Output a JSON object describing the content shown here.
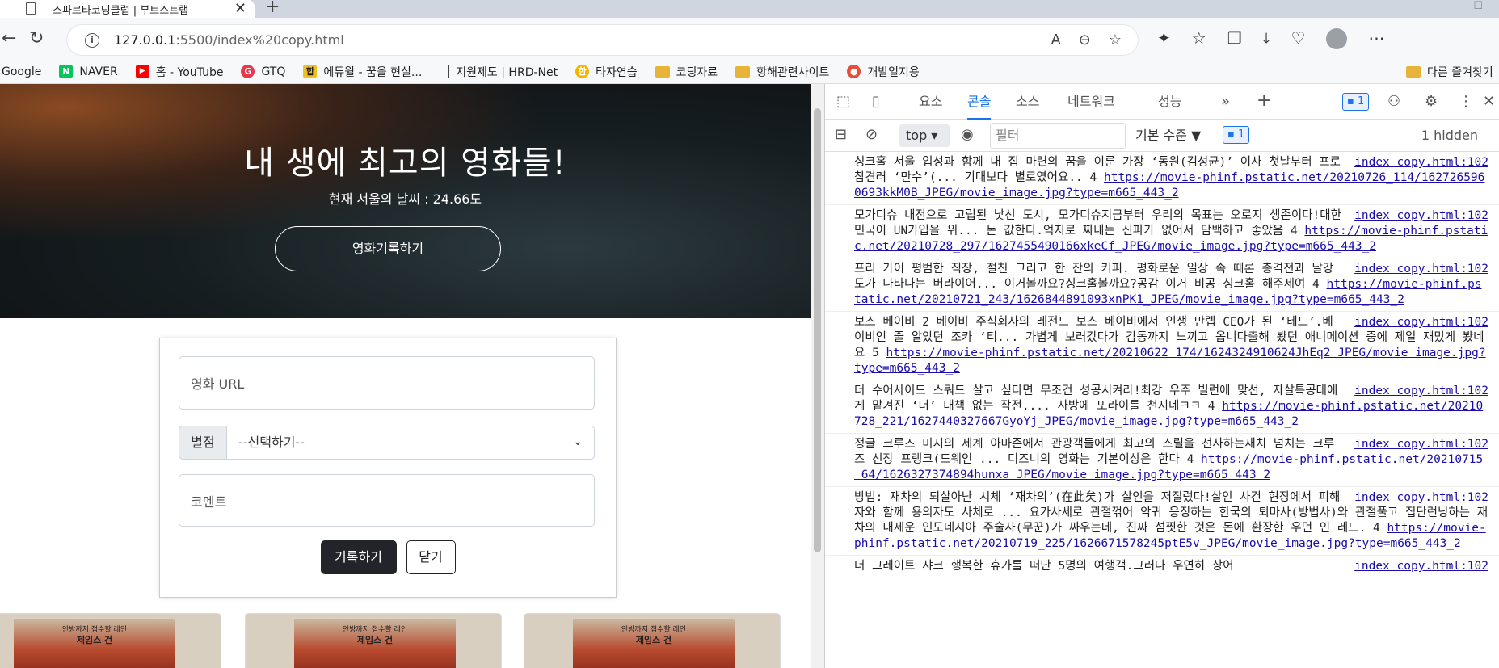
{
  "browser": {
    "tab_title": "스파르타코딩클럽 | 부트스트랩 ",
    "url_host": "127.0.0.1",
    "url_rest": ":5500/index%20copy.html",
    "bookmarks": [
      {
        "label": "Google",
        "color": "#ffffff",
        "type": "text"
      },
      {
        "label": "NAVER",
        "color": "#03c75a",
        "type": "icon",
        "glyph": "N"
      },
      {
        "label": "홈 - YouTube",
        "color": "#ff0000",
        "type": "icon",
        "glyph": "▶"
      },
      {
        "label": "GTQ",
        "color": "#e8384f",
        "type": "icon",
        "glyph": "G"
      },
      {
        "label": "에듀윌 - 꿈을 현실...",
        "color": "#f0c020",
        "type": "icon",
        "glyph": "합"
      },
      {
        "label": "지원제도 | HRD-Net",
        "color": "#ffffff",
        "type": "doc"
      },
      {
        "label": "타자연습",
        "color": "#f5b400",
        "type": "icon",
        "glyph": "한"
      },
      {
        "label": "코딩자료",
        "color": "#e8b33b",
        "type": "folder"
      },
      {
        "label": "항해관련사이트",
        "color": "#e8b33b",
        "type": "folder"
      },
      {
        "label": "개발일지용",
        "color": "#e84c3d",
        "type": "icon",
        "glyph": "●"
      }
    ],
    "other_bookmarks": "다른 즐겨찾기"
  },
  "hero": {
    "title": "내 생에 최고의 영화들!",
    "weather": "현재 서울의 날씨 : 24.66도",
    "record_button": "영화기록하기"
  },
  "form": {
    "url_placeholder": "영화 URL",
    "star_label": "별점",
    "star_select": "--선택하기--",
    "comment_placeholder": "코멘트",
    "save_button": "기록하기",
    "close_button": "닫기"
  },
  "cards": [
    {
      "line1": "안방까지 접수할 레인",
      "line2": "제임스 건"
    },
    {
      "line1": "안방까지 접수할 레인",
      "line2": "제임스 건"
    },
    {
      "line1": "안방까지 접수할 레인",
      "line2": "제임스 건"
    }
  ],
  "devtools": {
    "tabs": [
      "요소",
      "콘솔",
      "소스",
      "네트워크",
      "성능"
    ],
    "active_tab": "콘솔",
    "issue_count": "1",
    "context": "top",
    "filter_placeholder": "필터",
    "levels": "기본 수준",
    "levels_badge": "1",
    "hidden": "1 hidden",
    "messages": [
      {
        "text": "싱크홀 서울 입성과 함께 내 집 마련의 꿈을 이룬 가장 ‘동원(김성균)’ 이사 첫날부터 프로 참견러 ‘만수’(... 기대보다 별로였어요.. 4 ",
        "link": "https://movie-phinf.pstatic.net/20210726_114/1627265960693kkM0B_JPEG/movie_image.jpg?type=m665_443_2",
        "src": "index copy.html:102"
      },
      {
        "text": "모가디슈 내전으로 고립된 낯선 도시, 모가디슈지금부터 우리의 목표는 오로지 생존이다!대한민국이 UN가입을 위... 돈 값한다.억지로 짜내는 신파가 없어서 담백하고 좋았음 4 ",
        "link": "https://movie-phinf.pstatic.net/20210728_297/1627455490166xkeCf_JPEG/movie_image.jpg?type=m665_443_2",
        "src": "index copy.html:102"
      },
      {
        "text": "프리 가이 평범한 직장, 절친 그리고 한 잔의 커피. 평화로운 일상 속 때론 총격전과 날강도가 나타나는 버라이어... 이거볼까요?싱크홀볼까요?공감 이거 비공 싱크홀 해주세여 4 ",
        "link": "https://movie-phinf.pstatic.net/20210721_243/1626844891093xnPK1_JPEG/movie_image.jpg?type=m665_443_2",
        "src": "index copy.html:102"
      },
      {
        "text": "보스 베이비 2 베이비 주식회사의 레전드 보스 베이비에서 인생 만렙 CEO가 된 ‘테드’.베이비인 줄 알았던 조카 ‘티... 가볍게 보러갔다가 감동까지 느끼고 옵니다출해 봤던 애니메이션 중에 제일 재밌게 봤네요 5 ",
        "link": "https://movie-phinf.pstatic.net/20210622_174/1624324910624JhEq2_JPEG/movie_image.jpg?type=m665_443_2",
        "src": "index copy.html:102"
      },
      {
        "text": "더 수어사이드 스쿼드 살고 싶다면 무조건 성공시켜라!최강 우주 빌런에 맞선, 자살특공대에게 맡겨진 ‘더’ 대책 없는 작전.... 사방에 또라이를 천지네ㅋㅋ 4 ",
        "link": "https://movie-phinf.pstatic.net/20210728_221/1627440327667GyoYj_JPEG/movie_image.jpg?type=m665_443_2",
        "src": "index copy.html:102"
      },
      {
        "text": "정글 크루즈 미지의 세계 아마존에서 관광객들에게 최고의 스릴을 선사하는재치 넘치는 크루즈 선장 프랭크(드웨인 ... 디즈니의 영화는 기본이상은 한다 4 ",
        "link": "https://movie-phinf.pstatic.net/20210715_64/1626327374894hunxa_JPEG/movie_image.jpg?type=m665_443_2",
        "src": "index copy.html:102"
      },
      {
        "text": "방법: 재차의 되살아난 시체 ‘재차의’(在此矣)가 살인을 저질렀다!살인 사건 현장에서 피해자와 함께 용의자도 사체로 ... 요가사세로 관절꺾어 악귀 응징하는 한국의 퇴마사(방법사)와 관절풀고 집단런닝하는 재차의 내세운 인도네시아 주술사(무꾼)가 싸우는데, 진짜 섬찟한 것은 돈에 환장한 우먼 인 레드. 4 ",
        "link": "https://movie-phinf.pstatic.net/20210719_225/1626671578245ptE5v_JPEG/movie_image.jpg?type=m665_443_2",
        "src": "index copy.html:102"
      },
      {
        "text": "더 그레이트 샤크 행복한 휴가를 떠난 5명의 여행객.그러나 우연히 상어",
        "link": "",
        "src": "index copy.html:102"
      }
    ]
  }
}
